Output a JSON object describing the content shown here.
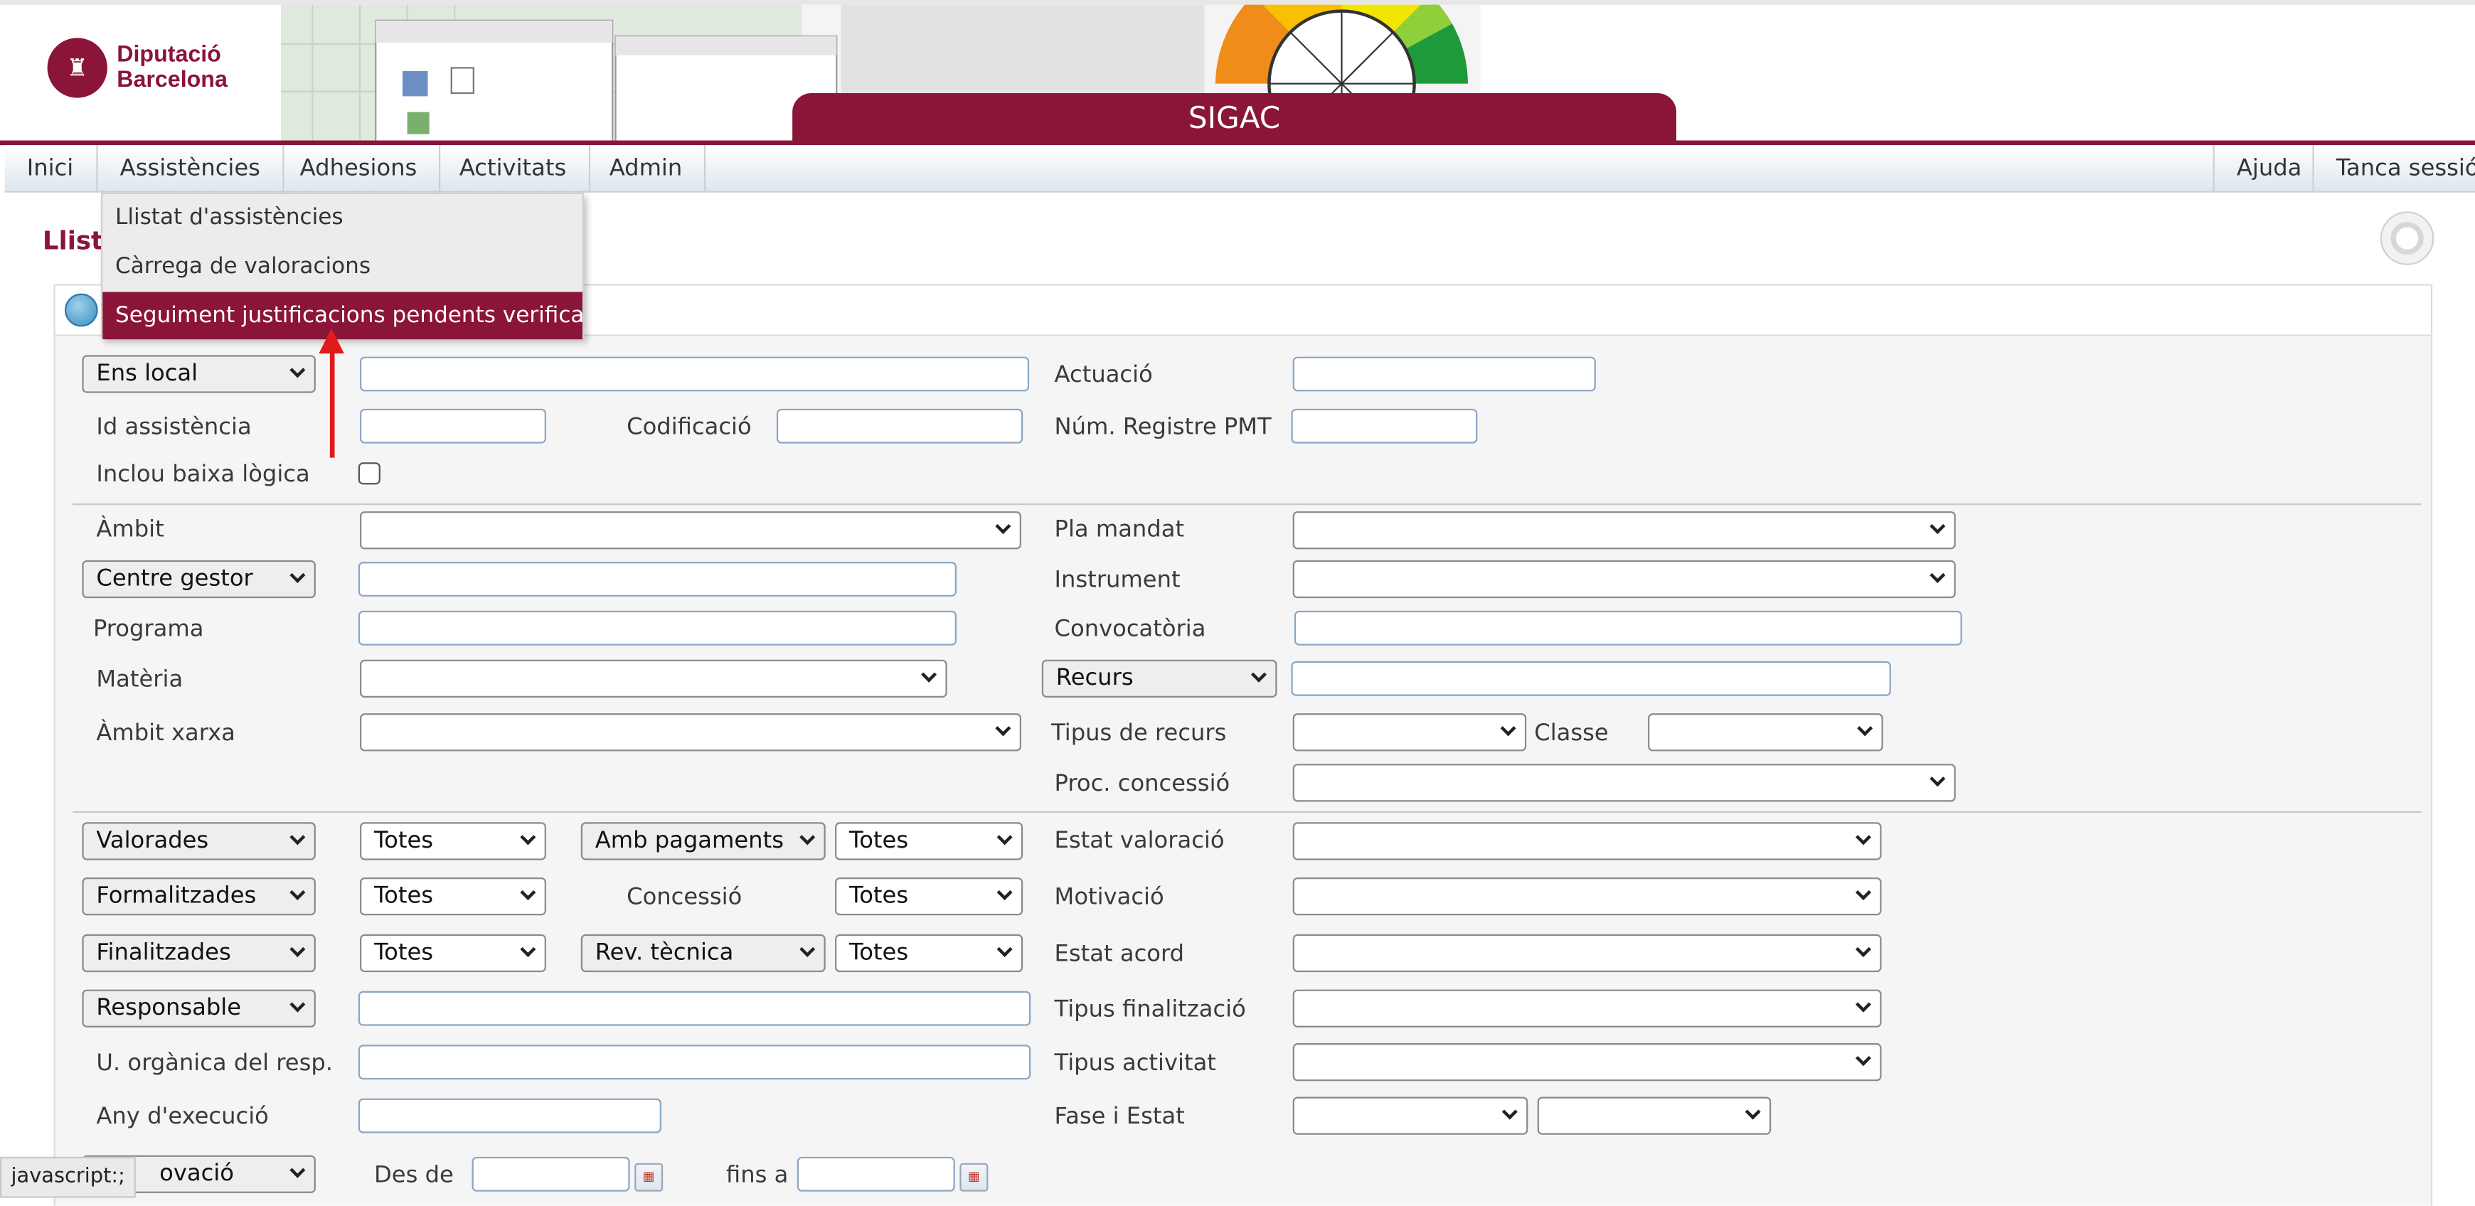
{
  "header": {
    "logo_line1": "Diputació",
    "logo_line2": "Barcelona",
    "app_title": "SIGAC"
  },
  "nav": {
    "items": [
      "Inici",
      "Assistències",
      "Adhesions",
      "Activitats",
      "Admin"
    ],
    "right_items": [
      "Ajuda",
      "Tanca sessió"
    ]
  },
  "dropdown": {
    "items": [
      "Llistat d'assistències",
      "Càrrega de valoracions",
      "Seguiment justificacions pendents verificar"
    ]
  },
  "page": {
    "title_visible": "Llista"
  },
  "filters": {
    "ens_local": "Ens local",
    "actuacio": "Actuació",
    "id_assistencia": "Id assistència",
    "codificacio": "Codificació",
    "num_registre": "Núm. Registre PMT",
    "inclou_baixa": "Inclou baixa lògica",
    "ambit": "Àmbit",
    "pla_mandat": "Pla mandat",
    "centre_gestor": "Centre gestor",
    "instrument": "Instrument",
    "programa": "Programa",
    "convocatoria": "Convocatòria",
    "materia": "Matèria",
    "recurs": "Recurs",
    "ambit_xarxa": "Àmbit xarxa",
    "tipus_recurs": "Tipus de recurs",
    "classe": "Classe",
    "proc_concessio": "Proc. concessió",
    "valorades": "Valorades",
    "totes": "Totes",
    "amb_pagaments": "Amb pagaments",
    "estat_valoracio": "Estat valoració",
    "formalitzades": "Formalitzades",
    "concessio": "Concessió",
    "motivacio": "Motivació",
    "finalitzades": "Finalitzades",
    "rev_tecnica": "Rev. tècnica",
    "estat_acord": "Estat acord",
    "responsable": "Responsable",
    "tipus_finalitzacio": "Tipus finalització",
    "u_organica": "U. orgànica del resp.",
    "tipus_activitat": "Tipus activitat",
    "any_execucio": "Any d'execució",
    "fase_estat": "Fase i Estat",
    "aprovacio_partial": "ovació",
    "des_de": "Des de",
    "fins_a": "fins a"
  },
  "status_bar": "javascript:;",
  "colors": {
    "brand": "#8a1538",
    "arrow": "#e01b1b",
    "panel_bg": "#f5f5f5"
  }
}
